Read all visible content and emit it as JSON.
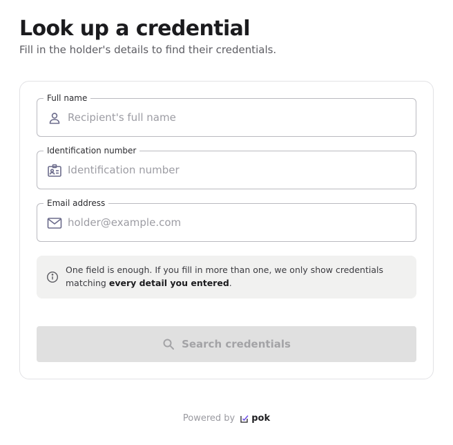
{
  "header": {
    "title": "Look up a credential",
    "subtitle": "Fill in the holder's details to find their credentials."
  },
  "form": {
    "full_name": {
      "label": "Full name",
      "placeholder": "Recipient's full name",
      "value": "",
      "icon": "person-icon"
    },
    "id_number": {
      "label": "Identification number",
      "placeholder": "Identification number",
      "value": "",
      "icon": "id-card-icon"
    },
    "email": {
      "label": "Email address",
      "placeholder": "holder@example.com",
      "value": "",
      "icon": "mail-icon"
    },
    "info": {
      "text_before": "One field is enough. If you fill in more than one, we only show credentials matching ",
      "text_bold": "every detail you entered",
      "text_after": ".",
      "icon": "info-icon"
    },
    "search_button": {
      "label": "Search credentials",
      "icon": "search-icon",
      "disabled": true
    }
  },
  "footer": {
    "powered_by": "Powered by",
    "brand": "pok",
    "brand_icon": "pok-logo-icon"
  },
  "colors": {
    "title": "#1b1b1e",
    "border": "#b9b9bf",
    "info_bg": "#f1f1f0",
    "button_disabled_bg": "#e0e0e0",
    "button_disabled_text": "#a3a3a6",
    "icon": "#6a6a8a"
  }
}
